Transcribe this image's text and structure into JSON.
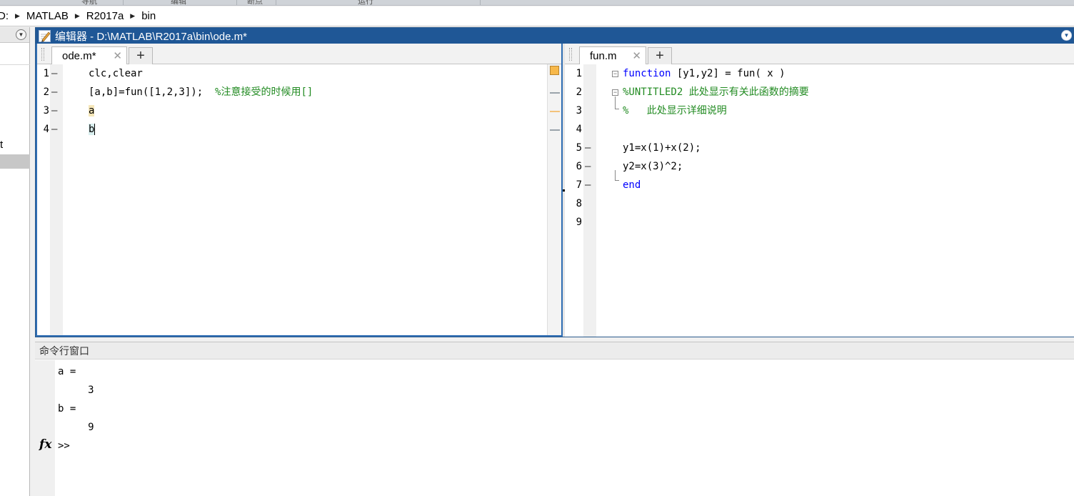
{
  "ribbon": {
    "tabs": [
      "导航",
      "编辑",
      "断点",
      "运行"
    ]
  },
  "address": {
    "crumbs": [
      "D:",
      "MATLAB",
      "R2017a",
      "bin"
    ]
  },
  "left_panel": {
    "visible_text": "t"
  },
  "editor": {
    "title": "编辑器 - D:\\MATLAB\\R2017a\\bin\\ode.m*",
    "left_tab": {
      "label": "ode.m*"
    },
    "right_tab": {
      "label": "fun.m"
    },
    "left_lines": [
      {
        "num": "1",
        "dash": "—",
        "code": "clc,clear"
      },
      {
        "num": "2",
        "dash": "—",
        "code_pre": "[a,b]=fun([1,2,3]);  ",
        "comment": "%注意接受的时候用[]"
      },
      {
        "num": "3",
        "dash": "—",
        "code": "a"
      },
      {
        "num": "4",
        "dash": "—",
        "code": "b"
      }
    ],
    "right_lines": [
      {
        "num": "1",
        "dash": "",
        "kw": "function",
        "code": " [y1,y2] = fun( x )"
      },
      {
        "num": "2",
        "dash": "",
        "comment": "%UNTITLED2 此处显示有关此函数的摘要"
      },
      {
        "num": "3",
        "dash": "",
        "comment": "%   此处显示详细说明"
      },
      {
        "num": "4",
        "dash": "",
        "code": ""
      },
      {
        "num": "5",
        "dash": "—",
        "code": "y1=x(1)+x(2);"
      },
      {
        "num": "6",
        "dash": "—",
        "code": "y2=x(3)^2;"
      },
      {
        "num": "7",
        "dash": "—",
        "kw": "end"
      },
      {
        "num": "8",
        "dash": "",
        "code": ""
      },
      {
        "num": "9",
        "dash": "",
        "code": ""
      }
    ]
  },
  "command_window": {
    "title": "命令行窗口",
    "lines": [
      "a =",
      "     3",
      "b =",
      "     9"
    ],
    "prompt": ">>",
    "fx_label": "fx"
  },
  "colors": {
    "title_blue": "#1f5796",
    "keyword": "#0000ff",
    "comment": "#228b22",
    "warning_mark": "#f7b84a"
  }
}
